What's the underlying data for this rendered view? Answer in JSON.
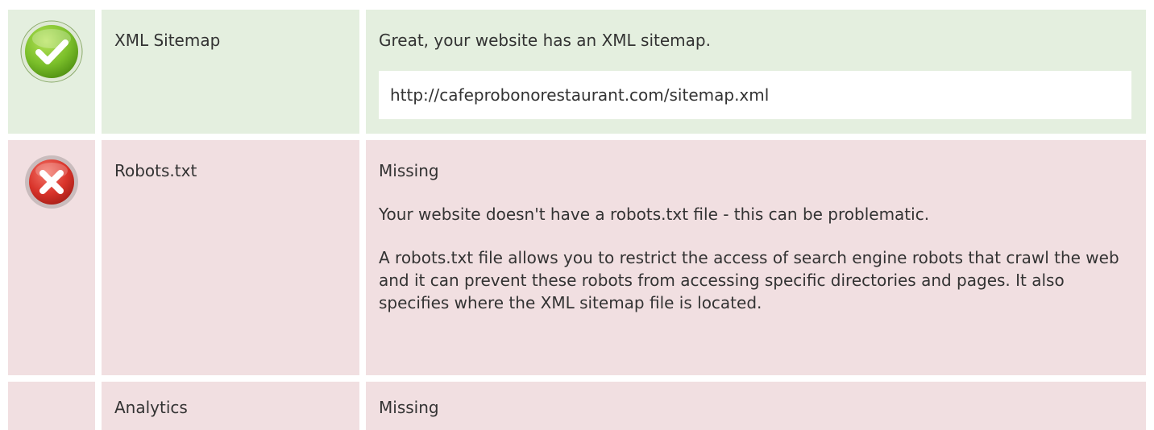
{
  "rows": [
    {
      "status": "pass",
      "label": "XML Sitemap",
      "message": "Great, your website has an XML sitemap.",
      "url": "http://cafeprobonorestaurant.com/sitemap.xml"
    },
    {
      "status": "fail",
      "label": "Robots.txt",
      "message": "Missing",
      "detail": "Your website doesn't have a robots.txt file - this can be problematic.",
      "explanation": "A robots.txt file allows you to restrict the access of search engine robots that crawl the web and it can prevent these robots from accessing specific directories and pages. It also specifies where the XML sitemap file is located."
    },
    {
      "status": "fail",
      "label": "Analytics",
      "message": "Missing"
    }
  ],
  "colors": {
    "pass_bg": "#e4efdf",
    "fail_bg": "#f1dfe1",
    "pass_icon": "#7bbf2a",
    "fail_icon": "#d9342b"
  },
  "icons": {
    "pass": "check-circle-icon",
    "fail": "cross-circle-icon"
  }
}
